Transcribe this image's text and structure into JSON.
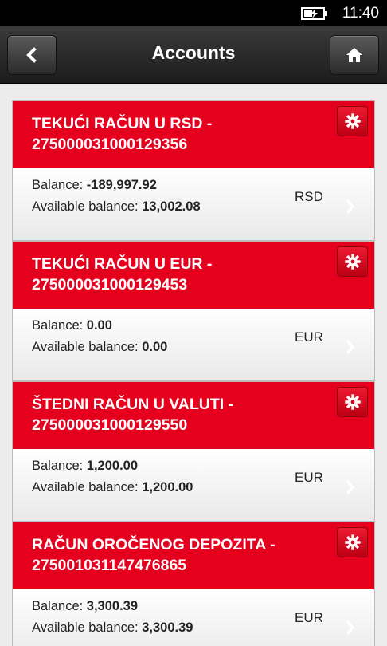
{
  "status": {
    "time": "11:40",
    "battery_icon": "battery-charging-icon"
  },
  "header": {
    "title": "Accounts",
    "back_icon": "chevron-left-icon",
    "home_icon": "home-icon"
  },
  "labels": {
    "balance": "Balance: ",
    "available": "Available balance: "
  },
  "colors": {
    "accent": "#e5001e",
    "header": "#2a2a2a",
    "background": "#ececec"
  },
  "accounts": [
    {
      "name": "TEKUĆI RAČUN U RSD -",
      "number": "275000031000129356",
      "balance": "-189,997.92",
      "available": "13,002.08",
      "currency": "RSD"
    },
    {
      "name": "TEKUĆI RAČUN U EUR -",
      "number": "275000031000129453",
      "balance": "0.00",
      "available": "0.00",
      "currency": "EUR"
    },
    {
      "name": "ŠTEDNI RAČUN U VALUTI -",
      "number": "275000031000129550",
      "balance": "1,200.00",
      "available": "1,200.00",
      "currency": "EUR"
    },
    {
      "name": "RAČUN OROČENOG DEPOZITA -",
      "number": "275001031147476865",
      "balance": "3,300.39",
      "available": "3,300.39",
      "currency": "EUR"
    }
  ]
}
